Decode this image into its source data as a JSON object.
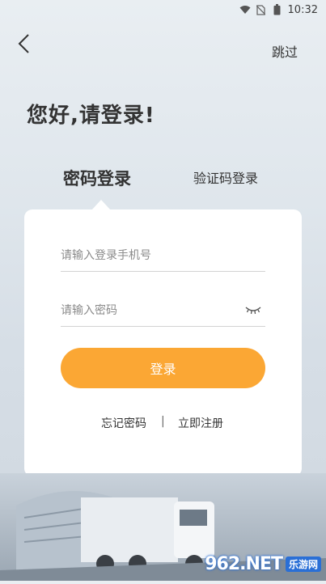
{
  "status_bar": {
    "time": "10:32",
    "icons": [
      "wifi-icon",
      "sim-off-icon",
      "battery-icon"
    ]
  },
  "header": {
    "back_icon": "chevron-left-icon",
    "skip_label": "跳过"
  },
  "greeting": "您好,请登录!",
  "tabs": [
    {
      "label": "密码登录",
      "active": true
    },
    {
      "label": "验证码登录",
      "active": false
    }
  ],
  "form": {
    "phone": {
      "placeholder": "请输入登录手机号",
      "value": ""
    },
    "password": {
      "placeholder": "请输入密码",
      "value": "",
      "toggle_icon": "eye-closed-icon"
    },
    "login_label": "登录"
  },
  "links": {
    "forgot": "忘记密码",
    "separator": "|",
    "register": "立即注册"
  },
  "colors": {
    "accent": "#fba734",
    "card": "#ffffff",
    "text": "#333333"
  },
  "watermark": {
    "brand": "962.NET",
    "site": "乐游网"
  }
}
